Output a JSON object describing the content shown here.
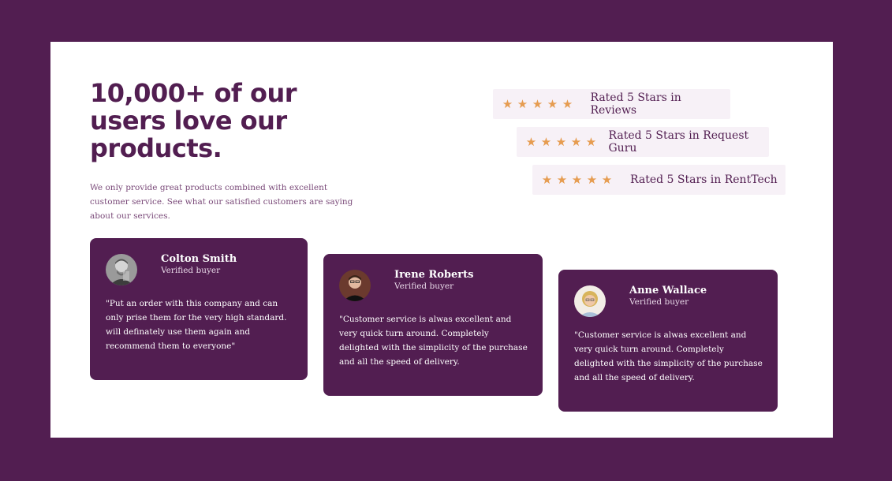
{
  "headline": "10,000+ of our users love our products.",
  "intro": "We only provide great products combined with excellent customer service. See what our satisfied customers are saying about our services.",
  "ratings": [
    {
      "label": "Rated 5 Stars in Reviews",
      "stars": 5
    },
    {
      "label": "Rated 5 Stars in Request Guru",
      "stars": 5
    },
    {
      "label": "Rated 5 Stars in RentTech",
      "stars": 5
    }
  ],
  "testimonials": [
    {
      "name": "Colton Smith",
      "status": "Verified buyer",
      "quote": "\"Put an order with this company and can only prise them for the very high standard. will definately use them again and recommend them to everyone\""
    },
    {
      "name": "Irene Roberts",
      "status": "Verified buyer",
      "quote": "\"Customer service is alwas excellent and very quick turn around. Completely delighted with the simplicity of the purchase and all the speed of delivery."
    },
    {
      "name": "Anne Wallace",
      "status": "Verified buyer",
      "quote": "\"Customer service is alwas excellent and very quick turn around. Completely delighted with the simplicity of the purchase and all the speed of delivery."
    }
  ],
  "icons": {
    "star": "star-icon",
    "avatar": "avatar"
  },
  "colors": {
    "background": "#521e51",
    "panel": "#ffffff",
    "accent_star": "#e69c50",
    "rating_bg": "#f7f1f7",
    "card_bg": "#521e51"
  }
}
